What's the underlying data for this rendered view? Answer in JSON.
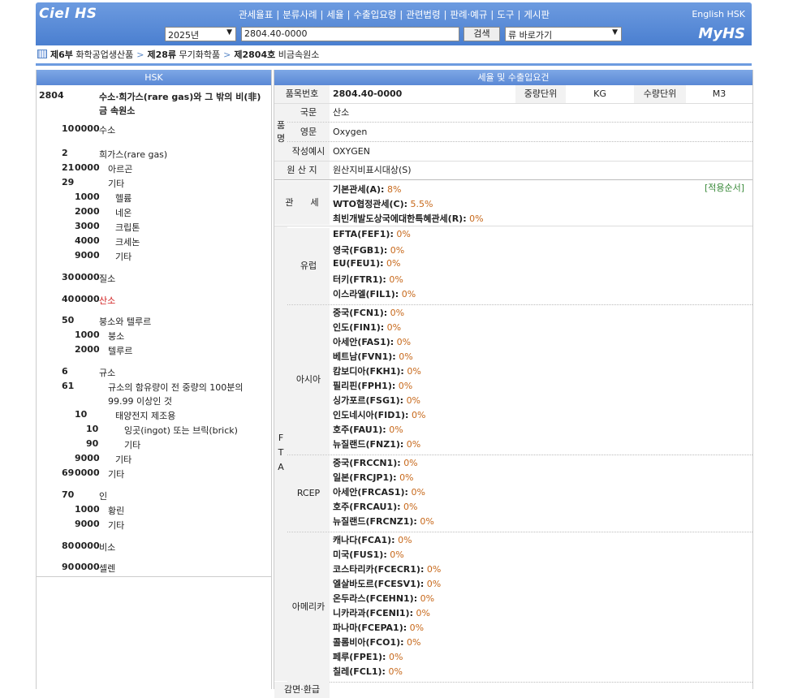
{
  "header": {
    "logo": "Ciel HS",
    "nav": [
      "관세율표",
      "분류사례",
      "세율",
      "수출입요령",
      "관련법령",
      "판례·예규",
      "도구",
      "게시판"
    ],
    "english_link": "English HSK",
    "myhs_link": "MyHS",
    "year_select": "2025년",
    "code_input": "2804.40-0000",
    "search_button": "검색",
    "jump_select": "류 바로가기"
  },
  "breadcrumb": {
    "part_code": "제6부",
    "part_name": "화학공업생산품",
    "chapter_code": "제28류",
    "chapter_name": "무기화학품",
    "heading_code": "제2804호",
    "heading_name": "비금속원소"
  },
  "hsk": {
    "panel_title": "HSK",
    "heading_code": "2804",
    "heading_desc": "수소·희가스(rare gas)와 그 밖의 비(非)금 속원소",
    "rows": [
      {
        "a": "10",
        "b": "0000",
        "c": "",
        "t": "수소"
      },
      {
        "a": "2",
        "b": "",
        "c": "",
        "t": "희가스(rare gas)"
      },
      {
        "a": "21",
        "b": "0000",
        "c": "",
        "t": "아르곤"
      },
      {
        "a": "29",
        "b": "",
        "c": "",
        "t": "기타"
      },
      {
        "a": "",
        "b": "1000",
        "c": "",
        "t": "헬륨"
      },
      {
        "a": "",
        "b": "2000",
        "c": "",
        "t": "네온"
      },
      {
        "a": "",
        "b": "3000",
        "c": "",
        "t": "크립톤"
      },
      {
        "a": "",
        "b": "4000",
        "c": "",
        "t": "크세논"
      },
      {
        "a": "",
        "b": "9000",
        "c": "",
        "t": "기타"
      },
      {
        "a": "30",
        "b": "0000",
        "c": "",
        "t": "질소"
      },
      {
        "a": "40",
        "b": "0000",
        "c": "",
        "t": "산소"
      },
      {
        "a": "50",
        "b": "",
        "c": "",
        "t": "붕소와 텔루르"
      },
      {
        "a": "",
        "b": "1000",
        "c": "",
        "t": "붕소"
      },
      {
        "a": "",
        "b": "2000",
        "c": "",
        "t": "텔루르"
      },
      {
        "a": "6",
        "b": "",
        "c": "",
        "t": "규소"
      },
      {
        "a": "61",
        "b": "",
        "c": "",
        "t": "규소의 함유량이 전 중량의 100분의"
      },
      {
        "a": "",
        "b": "",
        "c": "",
        "t": "99.99 이상인 것"
      },
      {
        "a": "",
        "b": "10",
        "c": "",
        "t": "태양전지 제조용"
      },
      {
        "a": "",
        "b": "",
        "c": "10",
        "t": "잉곳(ingot) 또는 브릭(brick)"
      },
      {
        "a": "",
        "b": "",
        "c": "90",
        "t": "기타"
      },
      {
        "a": "",
        "b": "9000",
        "c": "",
        "t": "기타"
      },
      {
        "a": "69",
        "b": "0000",
        "c": "",
        "t": "기타"
      },
      {
        "a": "70",
        "b": "",
        "c": "",
        "t": "인"
      },
      {
        "a": "",
        "b": "1000",
        "c": "",
        "t": "황린"
      },
      {
        "a": "",
        "b": "9000",
        "c": "",
        "t": "기타"
      },
      {
        "a": "80",
        "b": "0000",
        "c": "",
        "t": "비소"
      },
      {
        "a": "90",
        "b": "0000",
        "c": "",
        "t": "셀렌"
      }
    ]
  },
  "detail": {
    "panel_title": "세율 및 수출입요건",
    "label_code": "품목번호",
    "code": "2804.40-0000",
    "label_weight_unit": "중량단위",
    "weight_unit": "KG",
    "label_qty_unit": "수량단위",
    "qty_unit": "M3",
    "label_pum": "품",
    "label_myeong": "명",
    "label_kor": "국문",
    "name_kor": "산소",
    "label_eng": "영문",
    "name_eng": "Oxygen",
    "label_example": "작성예시",
    "example": "OXYGEN",
    "label_origin": "원 산 지",
    "origin": "원산지비표시대상(S)",
    "label_tariff": "관      세",
    "apply_order": "[적용순서]",
    "tariffs": [
      {
        "name": "기본관세(A):",
        "rate": "8%"
      },
      {
        "name": "WTO협정관세(C):",
        "rate": "5.5%"
      },
      {
        "name": "최빈개발도상국에대한특혜관세(R):",
        "rate": "0%"
      }
    ],
    "fta_label": [
      "F",
      "T",
      "A"
    ],
    "fta_groups": [
      {
        "region": "유럽",
        "items": [
          {
            "name": "EFTA(FEF1):",
            "rate": "0%"
          },
          {
            "name": "영국(FGB1):",
            "rate": "0%"
          },
          {
            "name": "EU(FEU1):",
            "rate": "0%"
          },
          {
            "name": "터키(FTR1):",
            "rate": "0%"
          },
          {
            "name": "이스라엘(FIL1):",
            "rate": "0%"
          }
        ]
      },
      {
        "region": "아시아",
        "items": [
          {
            "name": "중국(FCN1):",
            "rate": "0%"
          },
          {
            "name": "인도(FIN1):",
            "rate": "0%"
          },
          {
            "name": "아세안(FAS1):",
            "rate": "0%"
          },
          {
            "name": "베트남(FVN1):",
            "rate": "0%"
          },
          {
            "name": "캄보디아(FKH1):",
            "rate": "0%"
          },
          {
            "name": "필리핀(FPH1):",
            "rate": "0%"
          },
          {
            "name": "싱가포르(FSG1):",
            "rate": "0%"
          },
          {
            "name": "인도네시아(FID1):",
            "rate": "0%"
          },
          {
            "name": "호주(FAU1):",
            "rate": "0%"
          },
          {
            "name": "뉴질랜드(FNZ1):",
            "rate": "0%"
          }
        ]
      },
      {
        "region": "RCEP",
        "items": [
          {
            "name": "중국(FRCCN1):",
            "rate": "0%"
          },
          {
            "name": "일본(FRCJP1):",
            "rate": "0%"
          },
          {
            "name": "아세안(FRCAS1):",
            "rate": "0%"
          },
          {
            "name": "호주(FRCAU1):",
            "rate": "0%"
          },
          {
            "name": "뉴질랜드(FRCNZ1):",
            "rate": "0%"
          }
        ]
      },
      {
        "region": "아메리카",
        "items": [
          {
            "name": "캐나다(FCA1):",
            "rate": "0%"
          },
          {
            "name": "미국(FUS1):",
            "rate": "0%"
          },
          {
            "name": "코스타리카(FCECR1):",
            "rate": "0%"
          },
          {
            "name": "엘살바도르(FCESV1):",
            "rate": "0%"
          },
          {
            "name": "온두라스(FCEHN1):",
            "rate": "0%"
          },
          {
            "name": "니카라과(FCENI1):",
            "rate": "0%"
          },
          {
            "name": "파나마(FCEPA1):",
            "rate": "0%"
          },
          {
            "name": "콜롬비아(FCO1):",
            "rate": "0%"
          },
          {
            "name": "페루(FPE1):",
            "rate": "0%"
          },
          {
            "name": "칠레(FCL1):",
            "rate": "0%"
          }
        ]
      }
    ],
    "label_bottom": "감면·환급"
  },
  "colors": {
    "header_blue": "#5a88d5",
    "rate_orange": "#c7681a",
    "apply_green": "#3a8a3a",
    "highlight_red": "#d02020"
  }
}
